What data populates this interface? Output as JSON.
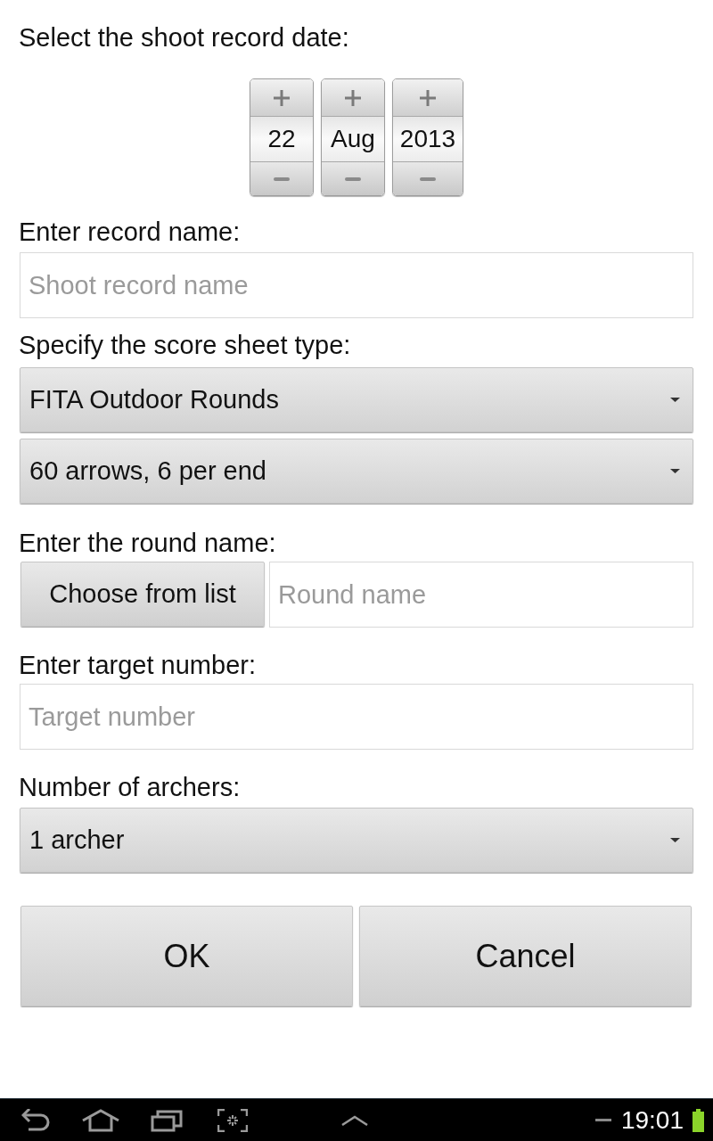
{
  "date_label": "Select the shoot record date:",
  "date_picker": [
    {
      "value": "22"
    },
    {
      "value": "Aug"
    },
    {
      "value": "2013"
    }
  ],
  "record_name": {
    "label": "Enter record name:",
    "placeholder": "Shoot record name"
  },
  "score_sheet": {
    "label": "Specify the score sheet type:",
    "dropdowns": [
      {
        "value": "FITA Outdoor Rounds"
      },
      {
        "value": "60 arrows, 6 per end"
      }
    ]
  },
  "round_name": {
    "label": "Enter the round name:",
    "button": "Choose from list",
    "placeholder": "Round name"
  },
  "target_number": {
    "label": "Enter target number:",
    "placeholder": "Target number"
  },
  "archers": {
    "label": "Number of archers:",
    "value": "1 archer"
  },
  "buttons": [
    "OK",
    "Cancel"
  ],
  "nav_bar": {
    "time": "19:01"
  }
}
